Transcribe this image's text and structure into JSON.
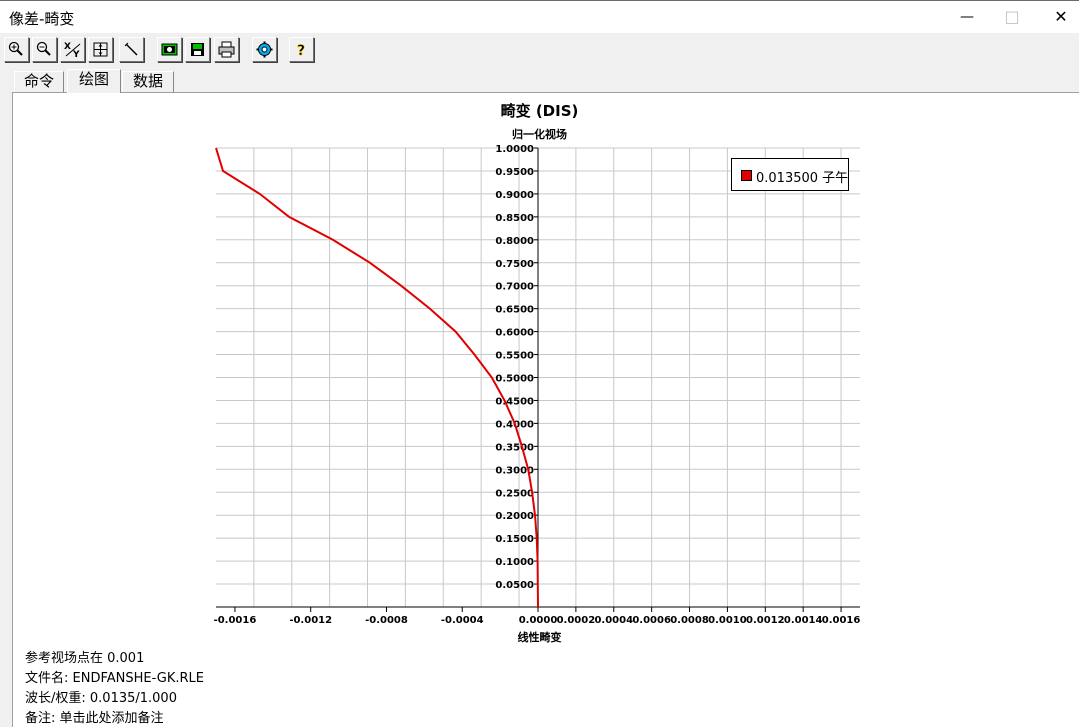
{
  "window": {
    "title": "像差-畸变",
    "minimize": "—",
    "maximize": "□",
    "close": "✕"
  },
  "toolbar": {
    "buttons": [
      {
        "name": "zoom-in-icon"
      },
      {
        "name": "zoom-out-icon"
      },
      {
        "name": "xy-icon"
      },
      {
        "name": "fit-icon"
      },
      {
        "name": "pen-icon"
      },
      {
        "name": "camera-icon"
      },
      {
        "name": "save-icon"
      },
      {
        "name": "print-icon"
      },
      {
        "name": "gear-icon"
      },
      {
        "name": "help-icon"
      }
    ]
  },
  "tabs": [
    {
      "label": "命令",
      "active": false
    },
    {
      "label": "绘图",
      "active": true
    },
    {
      "label": "数据",
      "active": false
    }
  ],
  "chart_data": {
    "type": "line",
    "title": "畸变 (DIS)",
    "ylabel": "归一化视场",
    "xlabel": "线性畸变",
    "xlim": [
      -0.0017,
      0.0017
    ],
    "ylim": [
      0,
      1.0
    ],
    "x_ticks": [
      "-0.0016",
      "-0.0012",
      "-0.0008",
      "-0.0004",
      "0.0000",
      "0.0002",
      "0.0004",
      "0.0006",
      "0.0008",
      "0.0010",
      "0.0012",
      "0.0014",
      "0.0016"
    ],
    "x_tick_values": [
      -0.0016,
      -0.0012,
      -0.0008,
      -0.0004,
      0.0,
      0.0002,
      0.0004,
      0.0006,
      0.0008,
      0.001,
      0.0012,
      0.0014,
      0.0016
    ],
    "y_ticks": [
      "0.0500",
      "0.1000",
      "0.1500",
      "0.2000",
      "0.2500",
      "0.3000",
      "0.3500",
      "0.4000",
      "0.4500",
      "0.5000",
      "0.5500",
      "0.6000",
      "0.6500",
      "0.7000",
      "0.7500",
      "0.8000",
      "0.8500",
      "0.9000",
      "0.9500",
      "1.0000"
    ],
    "grid": true,
    "legend_position": "top-right",
    "series": [
      {
        "name": "0.013500 子午",
        "color": "#e00000",
        "x": [
          0.0,
          -2e-06,
          -7e-06,
          -1.6e-05,
          -3.1e-05,
          -5.2e-05,
          -8.5e-05,
          -0.000123,
          -0.000177,
          -0.000244,
          -0.000336,
          -0.000435,
          -0.000571,
          -0.000723,
          -0.000887,
          -0.001083,
          -0.001314,
          -0.001469,
          -0.001663,
          -0.0017
        ],
        "y": [
          0.0,
          0.1,
          0.15,
          0.2,
          0.25,
          0.3,
          0.35,
          0.4,
          0.45,
          0.5,
          0.55,
          0.6,
          0.65,
          0.7,
          0.75,
          0.8,
          0.85,
          0.9,
          0.95,
          1.0
        ]
      }
    ]
  },
  "legend": {
    "label": "0.013500 子午",
    "color": "#e00000"
  },
  "info": {
    "ref_field": "参考视场点在  0.001",
    "file": "文件名:  ENDFANSHE-GK.RLE",
    "wavelength": "波长/权重:  0.0135/1.000",
    "note": "备注:  单击此处添加备注"
  }
}
